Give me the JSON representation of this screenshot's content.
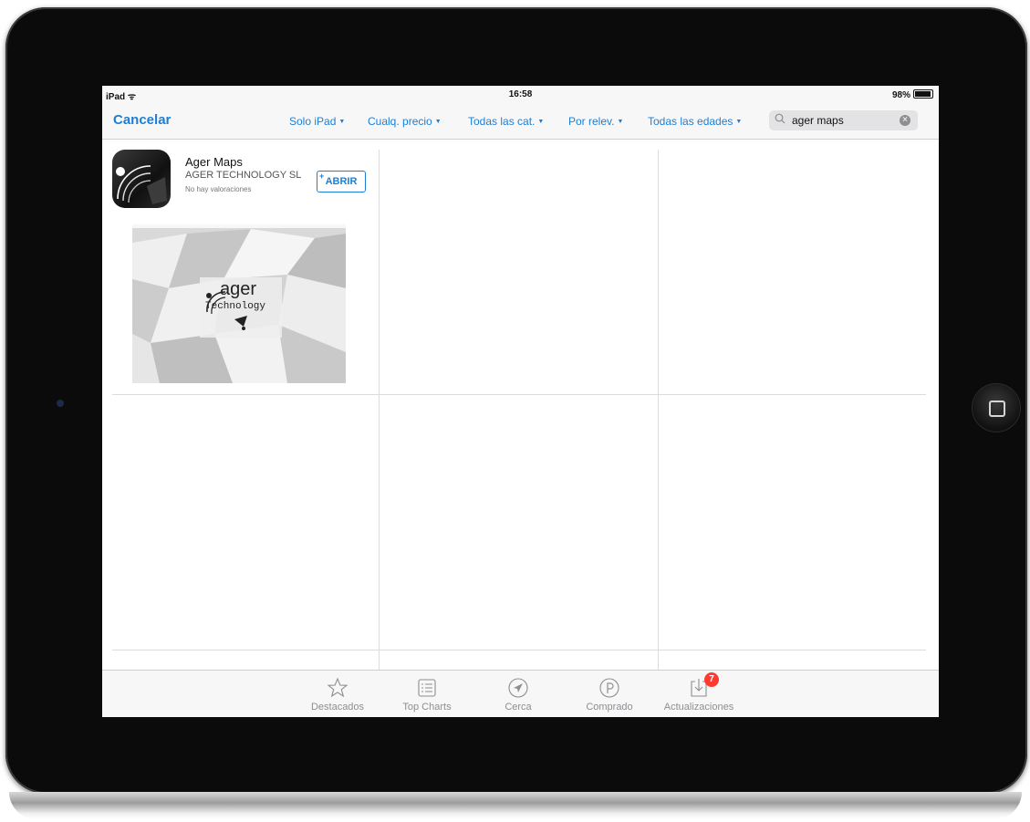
{
  "status_bar": {
    "device": "iPad ᯤ",
    "time": "16:58",
    "battery": "98%"
  },
  "nav": {
    "cancel_label": "Cancelar",
    "filters": [
      {
        "label": "Solo iPad"
      },
      {
        "label": "Cualq. precio"
      },
      {
        "label": "Todas las cat."
      },
      {
        "label": "Por relev."
      },
      {
        "label": "Todas las edades"
      }
    ],
    "search_value": "ager maps"
  },
  "result": {
    "app_name": "Ager Maps",
    "developer": "AGER TECHNOLOGY SL",
    "rating": "No hay valoraciones",
    "open_label": "ABRIR",
    "open_plus": "+",
    "screenshot_logo_main": "ager",
    "screenshot_logo_sub": "Technology"
  },
  "tab_bar": {
    "items": [
      {
        "label": "Destacados",
        "icon": "star-icon"
      },
      {
        "label": "Top Charts",
        "icon": "list-icon"
      },
      {
        "label": "Cerca",
        "icon": "location-icon"
      },
      {
        "label": "Comprado",
        "icon": "purchased-icon"
      },
      {
        "label": "Actualizaciones",
        "icon": "updates-icon",
        "badge": "7"
      }
    ]
  },
  "colors": {
    "accent": "#1a7fd8",
    "badge": "#ff3b30"
  }
}
